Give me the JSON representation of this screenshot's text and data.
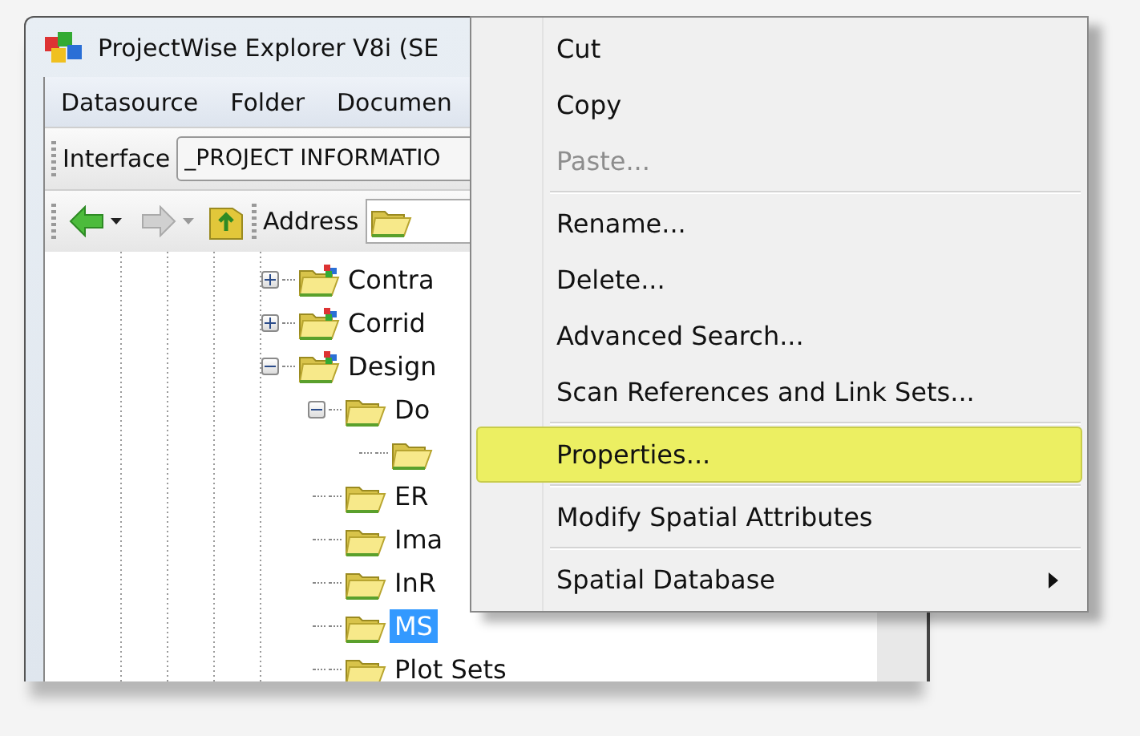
{
  "window": {
    "title": "ProjectWise Explorer V8i (SE"
  },
  "menu_bar": [
    {
      "label": "Datasource"
    },
    {
      "label": "Folder"
    },
    {
      "label": "Documen"
    }
  ],
  "interface_toolbar": {
    "label": "Interface",
    "value": "_PROJECT INFORMATIO"
  },
  "navigation_toolbar": {
    "address_label": "Address"
  },
  "tree": [
    {
      "label": "Contra",
      "kind": "project",
      "expanded": false,
      "selected": false
    },
    {
      "label": "Corrid",
      "kind": "project",
      "expanded": false,
      "selected": false
    },
    {
      "label": "Design",
      "kind": "project",
      "expanded": true,
      "selected": false,
      "children": [
        {
          "label": "Do",
          "kind": "folder",
          "expanded": true,
          "selected": false,
          "children": [
            {
              "kind": "folder",
              "selected": false
            }
          ]
        },
        {
          "label": "ER",
          "kind": "folder",
          "selected": false
        },
        {
          "label": "Ima",
          "kind": "folder",
          "selected": false
        },
        {
          "label": "InR",
          "kind": "folder",
          "selected": false
        },
        {
          "label": "MS",
          "kind": "folder",
          "selected": true
        },
        {
          "label": "Plot Sets",
          "kind": "folder",
          "selected": false
        }
      ]
    }
  ],
  "context_menu": [
    {
      "kind": "item",
      "label": "Cut",
      "disabled": false,
      "selected": false,
      "submenu": false
    },
    {
      "kind": "item",
      "label": "Copy",
      "disabled": false,
      "selected": false,
      "submenu": false
    },
    {
      "kind": "item",
      "label": "Paste...",
      "disabled": true,
      "selected": false,
      "submenu": false
    },
    {
      "kind": "separator"
    },
    {
      "kind": "item",
      "label": "Rename...",
      "disabled": false,
      "selected": false,
      "submenu": false
    },
    {
      "kind": "item",
      "label": "Delete...",
      "disabled": false,
      "selected": false,
      "submenu": false
    },
    {
      "kind": "item",
      "label": "Advanced Search...",
      "disabled": false,
      "selected": false,
      "submenu": false
    },
    {
      "kind": "item",
      "label": "Scan References and Link Sets...",
      "disabled": false,
      "selected": false,
      "submenu": false
    },
    {
      "kind": "separator"
    },
    {
      "kind": "item",
      "label": "Properties...",
      "disabled": false,
      "selected": true,
      "submenu": false
    },
    {
      "kind": "separator"
    },
    {
      "kind": "item",
      "label": "Modify Spatial Attributes",
      "disabled": false,
      "selected": false,
      "submenu": false
    },
    {
      "kind": "separator"
    },
    {
      "kind": "item",
      "label": "Spatial Database",
      "disabled": false,
      "selected": false,
      "submenu": true
    }
  ]
}
